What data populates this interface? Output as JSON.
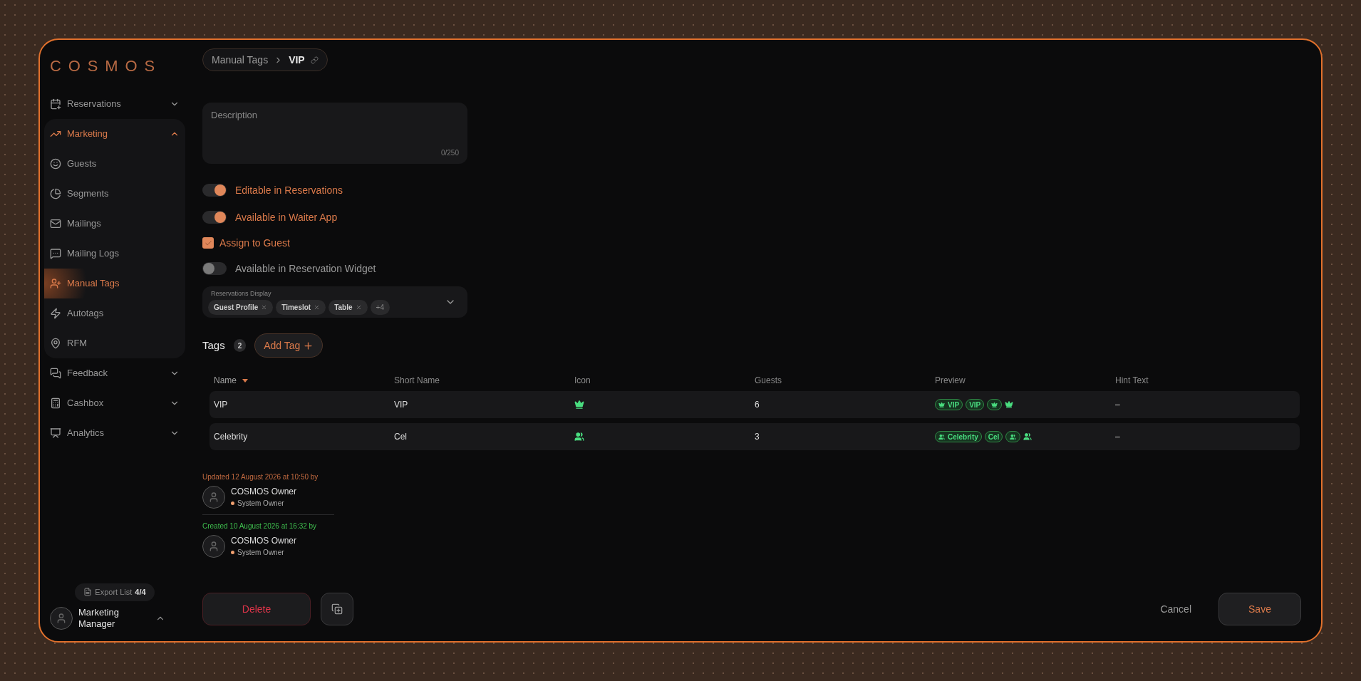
{
  "logo": "COSMOS",
  "sidebar": {
    "items": [
      {
        "label": "Reservations",
        "expanded": false,
        "selected": false
      },
      {
        "label": "Marketing",
        "expanded": true,
        "selected": true,
        "children": [
          {
            "label": "Guests",
            "selected": false
          },
          {
            "label": "Segments",
            "selected": false
          },
          {
            "label": "Mailings",
            "selected": false
          },
          {
            "label": "Mailing Logs",
            "selected": false
          },
          {
            "label": "Manual Tags",
            "selected": true
          },
          {
            "label": "Autotags",
            "selected": false
          },
          {
            "label": "RFM",
            "selected": false
          }
        ]
      },
      {
        "label": "Feedback",
        "expanded": false,
        "selected": false
      },
      {
        "label": "Cashbox",
        "expanded": false,
        "selected": false
      },
      {
        "label": "Analytics",
        "expanded": false,
        "selected": false
      }
    ]
  },
  "export": {
    "label": "Export List",
    "count": "4/4"
  },
  "user": {
    "name": "Marketing Manager"
  },
  "breadcrumb": [
    "Manual Tags",
    "VIP"
  ],
  "description": {
    "placeholder": "Description",
    "counter": "0/250"
  },
  "settings": [
    {
      "kind": "toggle",
      "label": "Editable in Reservations",
      "on": true
    },
    {
      "kind": "toggle",
      "label": "Available in Waiter App",
      "on": true
    },
    {
      "kind": "checkbox",
      "label": "Assign to Guest",
      "checked": true
    },
    {
      "kind": "toggle",
      "label": "Available in Reservation Widget",
      "on": false
    }
  ],
  "reservations_display": {
    "label": "Reservations Display",
    "chips": [
      "Guest Profile",
      "Timeslot",
      "Table"
    ],
    "more": "+4"
  },
  "tags": {
    "title": "Tags",
    "count": "2",
    "add_button": "Add Tag",
    "columns": [
      {
        "label": "Name",
        "sorted": true
      },
      {
        "label": "Short Name",
        "sorted": false
      },
      {
        "label": "Icon",
        "sorted": false
      },
      {
        "label": "Guests",
        "sorted": false
      },
      {
        "label": "Preview",
        "sorted": false
      },
      {
        "label": "Hint Text",
        "sorted": false
      }
    ],
    "rows": [
      {
        "name": "VIP",
        "short_name": "VIP",
        "kind": "crown",
        "guests": "6",
        "preview_full": "VIP",
        "preview_short": "VIP",
        "hint": "–"
      },
      {
        "name": "Celebrity",
        "short_name": "Cel",
        "kind": "group",
        "guests": "3",
        "preview_full": "Celebrity",
        "preview_short": "Cel",
        "hint": "–"
      }
    ]
  },
  "history": [
    {
      "kind": "updated",
      "text": "Updated 12 August 2026 at 10:50 by",
      "name": "COSMOS Owner",
      "role": "System Owner"
    },
    {
      "kind": "created",
      "text": "Created 10 August 2026 at 16:32 by",
      "name": "COSMOS Owner",
      "role": "System Owner"
    }
  ],
  "actions": {
    "delete": "Delete",
    "cancel": "Cancel",
    "save": "Save"
  }
}
